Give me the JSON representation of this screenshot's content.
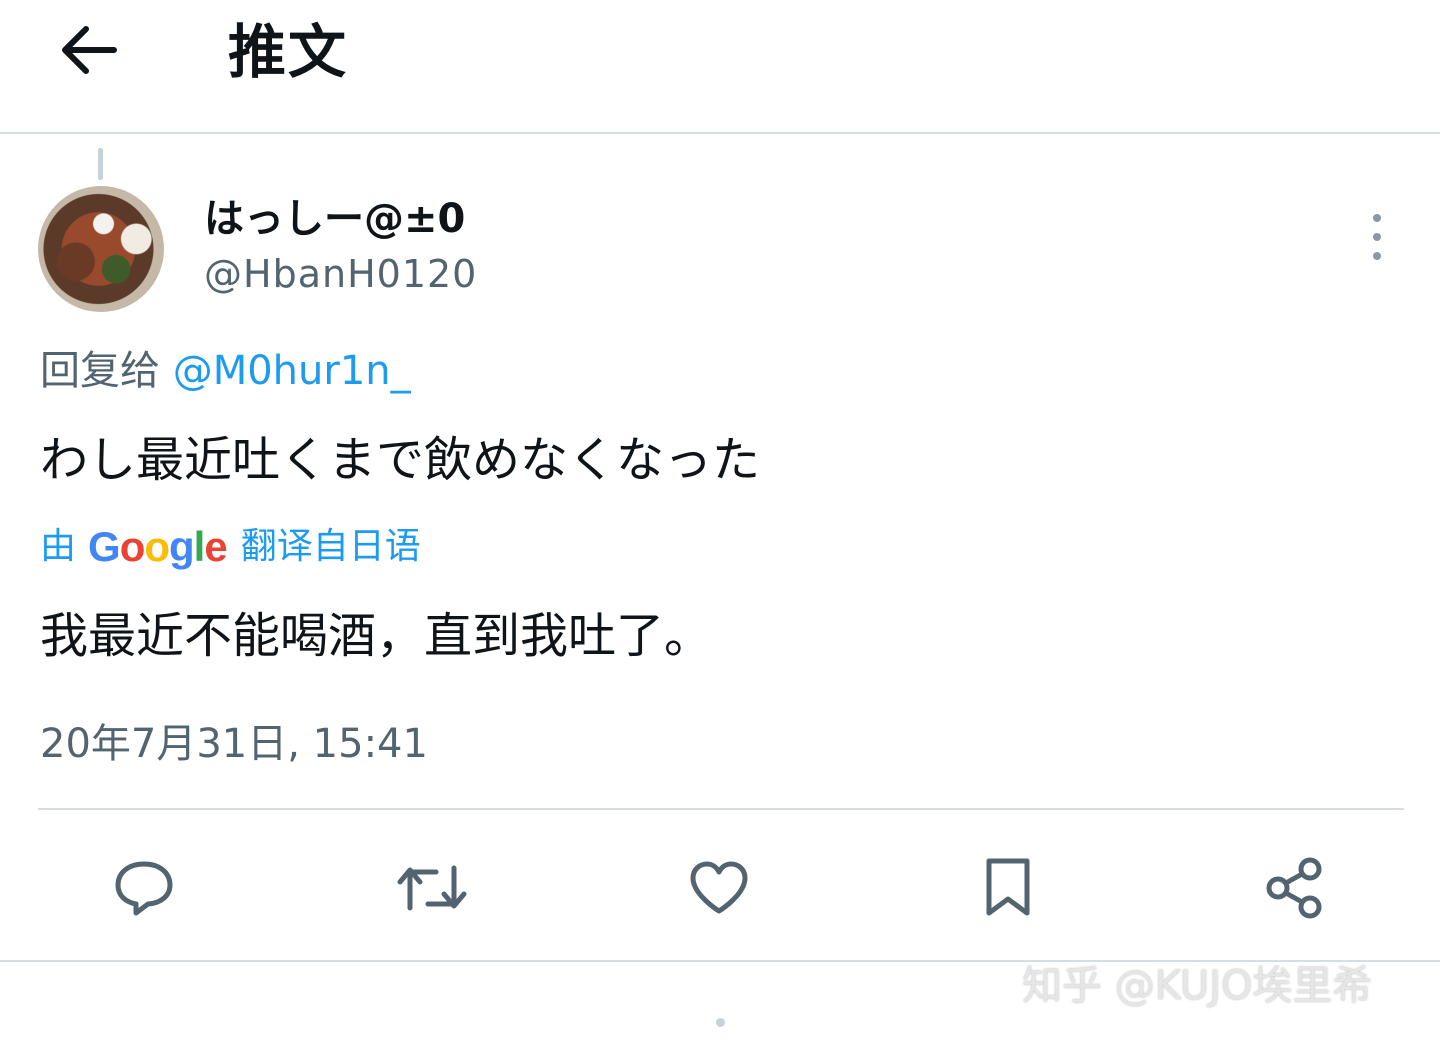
{
  "header": {
    "title": "推文",
    "back_icon": "arrow-left-icon"
  },
  "tweet": {
    "display_name": "はっしー@±0",
    "handle": "@HbanH0120",
    "reply_prefix": "回复给",
    "reply_mention": "@M0hur1n_",
    "text": "わし最近吐くまで飲めなくなった",
    "translate_prefix": "由",
    "translate_brand": "Google",
    "translate_suffix": "翻译自日语",
    "translated_text": "我最近不能喝酒，直到我吐了。",
    "timestamp": "20年7月31日, 15:41"
  },
  "actions": [
    {
      "name": "reply",
      "icon": "comment-icon"
    },
    {
      "name": "retweet",
      "icon": "retweet-icon"
    },
    {
      "name": "like",
      "icon": "heart-icon"
    },
    {
      "name": "bookmark",
      "icon": "bookmark-icon"
    },
    {
      "name": "share",
      "icon": "share-icon"
    }
  ],
  "watermark": "知乎 @KUJO埃里希",
  "colors": {
    "link": "#1d9bf0",
    "secondary_text": "#536471",
    "primary_text": "#0f1419",
    "divider": "#d9dde0"
  }
}
